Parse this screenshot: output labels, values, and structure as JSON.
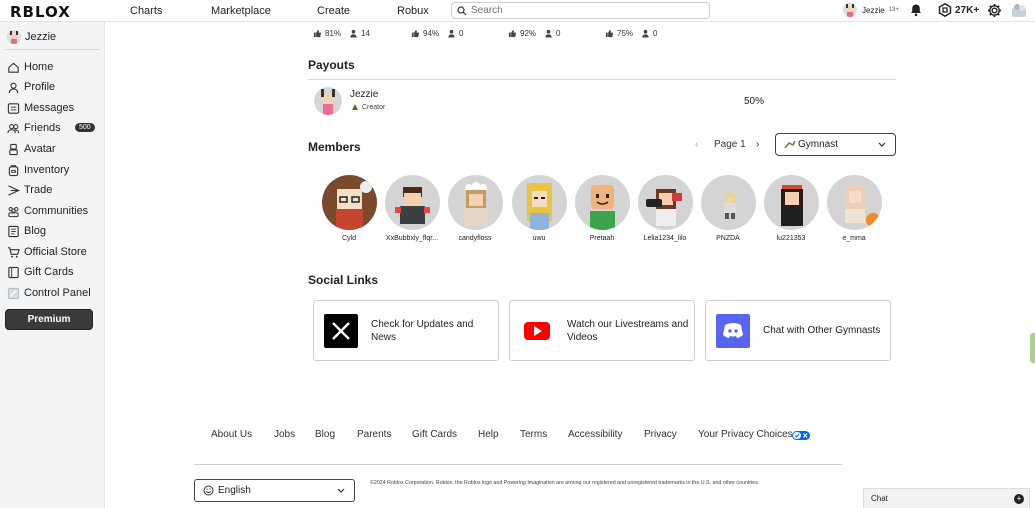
{
  "topbar": {
    "logo": "RBLOX",
    "nav": [
      "Charts",
      "Marketplace",
      "Create",
      "Robux"
    ],
    "search_placeholder": "Search",
    "username": "Jezzie",
    "age_badge": "13+",
    "robux": "27K+"
  },
  "sidebar": {
    "username": "Jezzie",
    "items": [
      {
        "label": "Home",
        "icon": "home-icon"
      },
      {
        "label": "Profile",
        "icon": "profile-icon"
      },
      {
        "label": "Messages",
        "icon": "messages-icon"
      },
      {
        "label": "Friends",
        "icon": "friends-icon"
      },
      {
        "label": "Avatar",
        "icon": "avatar-icon"
      },
      {
        "label": "Inventory",
        "icon": "inventory-icon"
      },
      {
        "label": "Trade",
        "icon": "trade-icon"
      },
      {
        "label": "Communities",
        "icon": "communities-icon"
      },
      {
        "label": "Blog",
        "icon": "blog-icon"
      },
      {
        "label": "Official Store",
        "icon": "store-icon"
      },
      {
        "label": "Gift Cards",
        "icon": "gift-card-icon"
      },
      {
        "label": "Control Panel",
        "icon": "control-panel-icon"
      }
    ],
    "friends_badge": "500",
    "premium_label": "Premium"
  },
  "stats": [
    {
      "likes": "81%",
      "players": "14"
    },
    {
      "likes": "94%",
      "players": "0"
    },
    {
      "likes": "92%",
      "players": "0"
    },
    {
      "likes": "75%",
      "players": "0"
    }
  ],
  "payouts": {
    "title": "Payouts",
    "name": "Jezzie",
    "role": "Creator",
    "percent": "50%"
  },
  "members": {
    "title": "Members",
    "page_label": "Page 1",
    "role_filter": "Gymnast",
    "list": [
      "Cyld",
      "XxBubbxly_flqr...",
      "candyfloss",
      "uwu",
      "Pretaah",
      "Lelia1234_lilo",
      "PNZDA",
      "lu221353",
      "e_mma"
    ]
  },
  "social": {
    "title": "Social Links",
    "cards": [
      {
        "text": "Check for Updates and News",
        "icon": "x-icon"
      },
      {
        "text": "Watch our Livestreams and Videos",
        "icon": "youtube-icon"
      },
      {
        "text": "Chat with Other Gymnasts",
        "icon": "discord-icon"
      }
    ]
  },
  "footer": {
    "links": [
      "About Us",
      "Jobs",
      "Blog",
      "Parents",
      "Gift Cards",
      "Help",
      "Terms",
      "Accessibility",
      "Privacy",
      "Your Privacy Choices"
    ],
    "language": "English",
    "copyright": "©2024 Roblox Corporation. Roblox, the Roblox logo and Powering Imagination are among our registered and unregistered trademarks in the U.S. and other countries."
  },
  "chat": {
    "label": "Chat"
  },
  "colors": {
    "premium_bg": "#393b3d",
    "youtube_red": "#ff0000",
    "discord_blurple": "#5865f2",
    "x_black": "#000000"
  }
}
